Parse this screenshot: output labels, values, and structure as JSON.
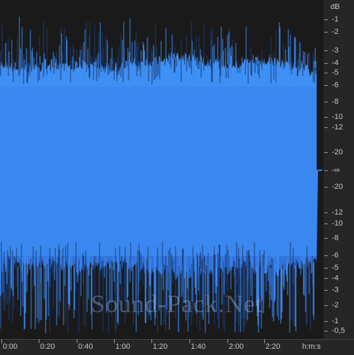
{
  "scale": {
    "unit": "dB",
    "ticks": [
      "-1",
      "-2",
      "-3",
      "-4",
      "-5",
      "-6",
      "-8",
      "-10",
      "-12",
      "-20",
      "-∞",
      "-20",
      "-12",
      "-10",
      "-8",
      "-6",
      "-5",
      "-4",
      "-3",
      "-2",
      "-1",
      "-0,5"
    ]
  },
  "time_axis": {
    "labels": [
      "0:00",
      "0:20",
      "0:40",
      "1:00",
      "1:20",
      "1:40",
      "2:00",
      "2:20"
    ],
    "unit": "h:m:s"
  },
  "watermark": "Sound-Pack.Net",
  "colors": {
    "background": "#1a1a1a",
    "wave_top": "#3b8cf0",
    "wave_bottom": "#2f6fd0",
    "spike": "#1c3b73"
  }
}
